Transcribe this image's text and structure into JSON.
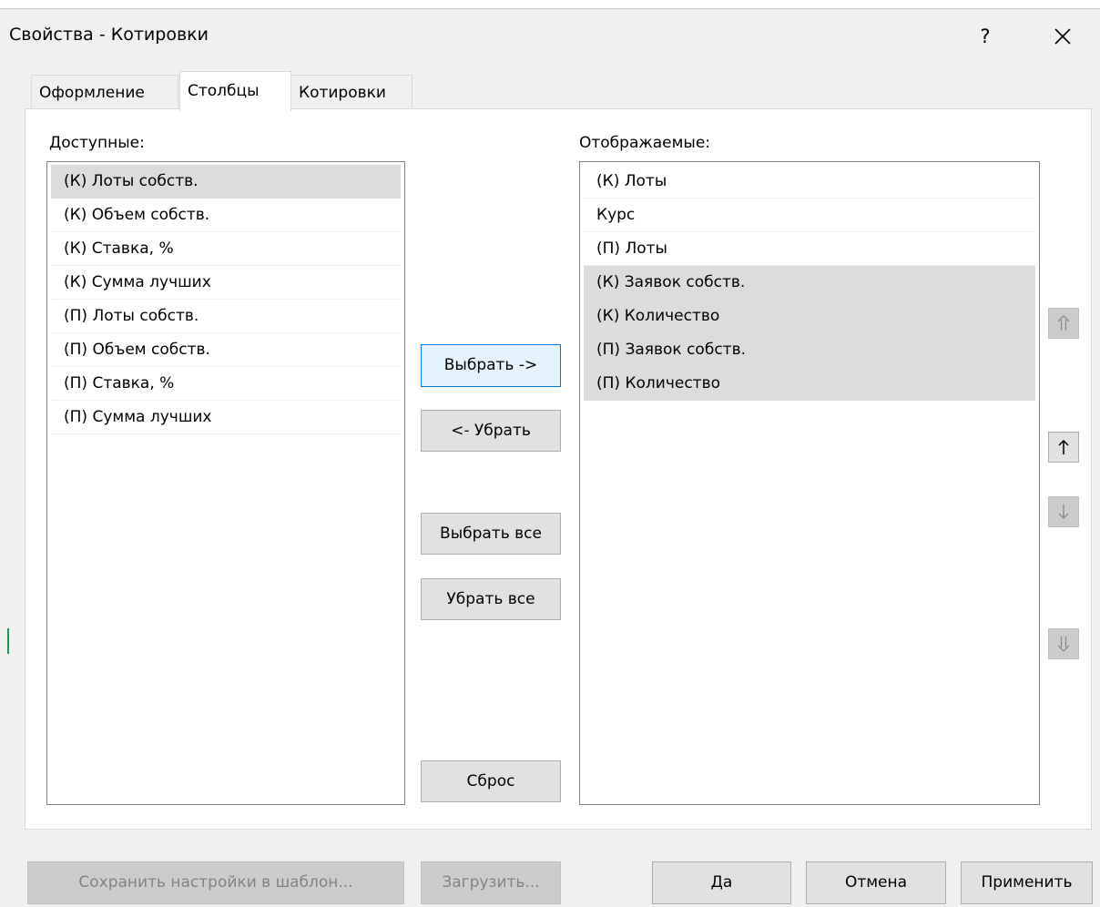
{
  "window": {
    "title": "Свойства - Котировки",
    "help_label": "?"
  },
  "tabs": [
    {
      "label": "Оформление",
      "active": false
    },
    {
      "label": "Столбцы",
      "active": true
    },
    {
      "label": "Котировки",
      "active": false
    }
  ],
  "available": {
    "label": "Доступные:",
    "items": [
      "(К) Лоты собств.",
      "(К) Объем собств.",
      "(К) Ставка, %",
      "(К) Сумма лучших",
      "(П) Лоты собств.",
      "(П) Объем собств.",
      "(П) Ставка, %",
      "(П) Сумма лучших"
    ],
    "selected_index": 0
  },
  "displayed": {
    "label": "Отображаемые:",
    "items": [
      "(К) Лоты",
      "Курс",
      "(П) Лоты",
      "(К) Заявок собств.",
      "(К) Количество",
      "(П) Заявок собств.",
      "(П) Количество"
    ],
    "selected_indices": [
      3,
      4,
      5,
      6
    ]
  },
  "middle_buttons": {
    "select": "Выбрать ->",
    "remove": "<- Убрать",
    "select_all": "Выбрать все",
    "remove_all": "Убрать все",
    "reset": "Сброс"
  },
  "bottom_buttons": {
    "save_template": "Сохранить настройки в шаблон...",
    "load": "Загрузить...",
    "ok": "Да",
    "cancel": "Отмена",
    "apply": "Применить"
  },
  "colors": {
    "focus_border": "#0078d7",
    "selection": "#dcdcdc",
    "disabled_bg": "#cccccc"
  }
}
